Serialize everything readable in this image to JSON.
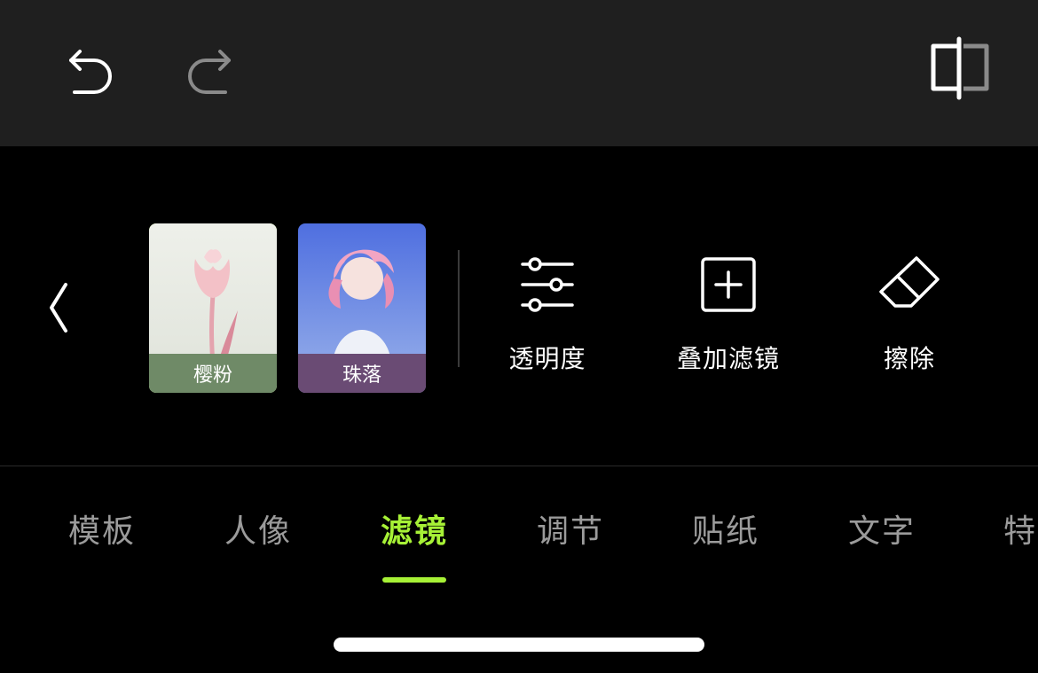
{
  "toolbar": {
    "undo_icon": "undo-icon",
    "redo_icon": "redo-icon",
    "compare_icon": "compare-icon"
  },
  "filters": [
    {
      "label": "樱粉",
      "selected": true,
      "label_bg": "#6f8a67"
    },
    {
      "label": "珠落",
      "selected": false,
      "label_bg": "#6a4b74"
    }
  ],
  "tools": [
    {
      "label": "透明度",
      "icon": "sliders-icon"
    },
    {
      "label": "叠加滤镜",
      "icon": "add-layer-icon"
    },
    {
      "label": "擦除",
      "icon": "eraser-icon"
    }
  ],
  "tabs": [
    {
      "label": "模板",
      "active": false
    },
    {
      "label": "人像",
      "active": false
    },
    {
      "label": "滤镜",
      "active": true
    },
    {
      "label": "调节",
      "active": false
    },
    {
      "label": "贴纸",
      "active": false
    },
    {
      "label": "文字",
      "active": false
    },
    {
      "label": "特",
      "active": false
    }
  ],
  "colors": {
    "accent": "#a7f136",
    "topbar_bg": "#1f1f1f",
    "panel_bg": "#000000",
    "inactive_tab": "#9b9b9b"
  }
}
